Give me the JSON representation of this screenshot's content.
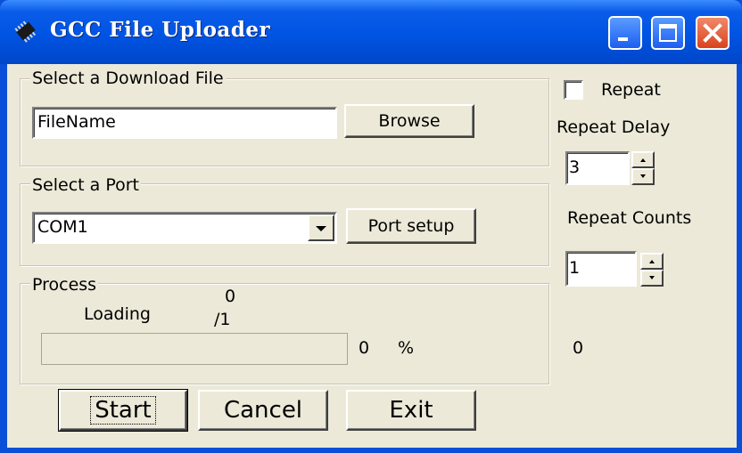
{
  "window": {
    "title": "GCC File Uploader"
  },
  "icons": {
    "app": "chip-icon",
    "minimize": "minimize-icon",
    "maximize": "maximize-icon",
    "close": "close-icon",
    "dropdown": "chevron-down-icon",
    "spin_up": "arrow-up-icon",
    "spin_down": "arrow-down-icon"
  },
  "download_group": {
    "legend": "Select a Download File",
    "filename_value": "FileName",
    "browse_label": "Browse"
  },
  "port_group": {
    "legend": "Select a Port",
    "selected_port": "COM1",
    "port_setup_label": "Port setup"
  },
  "process_group": {
    "legend": "Process",
    "loading_label": "Loading",
    "loaded_count": "0",
    "total_count": "/1",
    "percent_value": "0",
    "percent_sign": "%",
    "progress_fraction": 0
  },
  "side": {
    "repeat_label": "Repeat",
    "repeat_checked": false,
    "repeat_delay_label": "Repeat Delay",
    "repeat_delay_value": "3",
    "repeat_counts_label": "Repeat Counts",
    "repeat_counts_value": "1",
    "counter_value": "0"
  },
  "buttons": {
    "start": "Start",
    "cancel": "Cancel",
    "exit": "Exit"
  },
  "colors": {
    "titlebar": "#0054e3",
    "client": "#ece9d8",
    "close_button": "#d9421e"
  }
}
